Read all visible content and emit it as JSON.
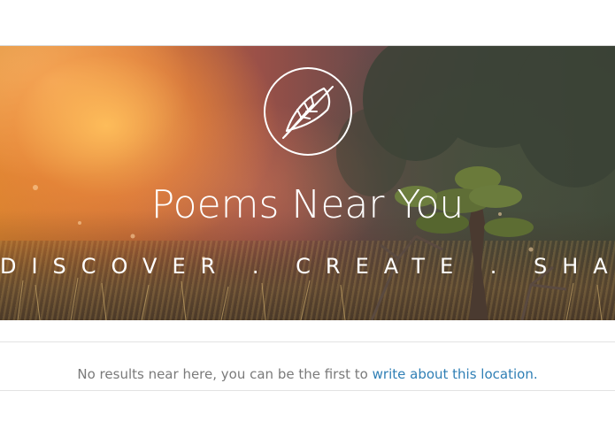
{
  "hero": {
    "title": "Poems Near You",
    "tagline": "DISCOVER . CREATE . SHARE",
    "logo_icon": "feather-quill-icon"
  },
  "results": {
    "message": "No results near here, you can be the first to ",
    "link_label": "write about this location",
    "trailing": "."
  },
  "colors": {
    "link": "#2f7fb5",
    "message_text": "#7a7a7a",
    "hero_text": "#ffffff"
  }
}
